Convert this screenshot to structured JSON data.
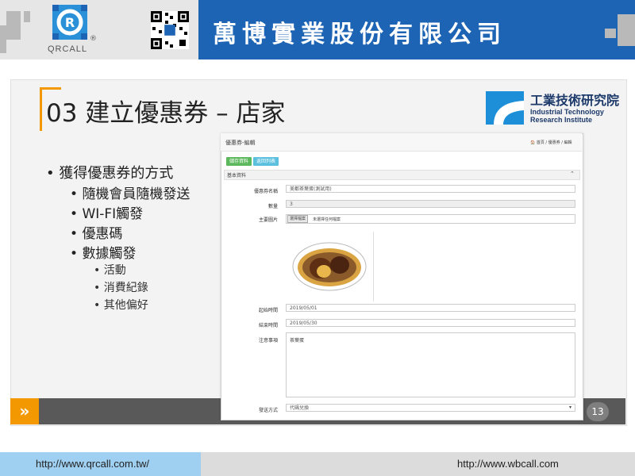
{
  "header": {
    "company_name": "萬博實業股份有限公司",
    "logo_text": "QRCALL",
    "reg_mark": "®"
  },
  "slide": {
    "title": "03 建立優惠券 – 店家",
    "partner": {
      "zh": "工業技術研究院",
      "en_line1": "Industrial Technology",
      "en_line2": "Research Institute"
    },
    "bullets": [
      {
        "text": "獲得優惠券的方式",
        "level": 1
      },
      {
        "text": "隨機會員隨機發送",
        "level": 2
      },
      {
        "text": "WI-FI觸發",
        "level": 2
      },
      {
        "text": "優惠碼",
        "level": 2
      },
      {
        "text": "數據觸發",
        "level": 2
      },
      {
        "text": "活動",
        "level": 3
      },
      {
        "text": "消費紀錄",
        "level": 3
      },
      {
        "text": "其他偏好",
        "level": 3
      }
    ],
    "page_number": "13",
    "arrow": "»"
  },
  "form": {
    "title": "優惠券-編輯",
    "breadcrumb": "🏠 首頁 / 優惠券 / 編輯",
    "buttons": {
      "save": "儲存資料",
      "back": "返回列表"
    },
    "section": "基本資料",
    "fields": {
      "name_label": "優惠券名稱",
      "name_value": "美都茶葉蛋(測試用)",
      "quantity_label": "數量",
      "quantity_value": "3",
      "image_label": "主要圖片",
      "file_button": "選擇檔案",
      "file_status": "未選擇任何檔案",
      "start_label": "起始時間",
      "start_value": "2019/05/01",
      "end_label": "結束時間",
      "end_value": "2019/05/30",
      "notes_label": "注意事項",
      "notes_value": "茶葉蛋",
      "delivery_label": "發送方式",
      "delivery_value": "代碼兌換"
    }
  },
  "footer": {
    "url_left": "http://www.qrcall.com.tw/",
    "url_right": "http://www.wbcall.com"
  },
  "colors": {
    "brand_blue": "#1e64b4",
    "accent_orange": "#f39800",
    "button_green": "#5cb85c",
    "button_cyan": "#5bc0de"
  }
}
